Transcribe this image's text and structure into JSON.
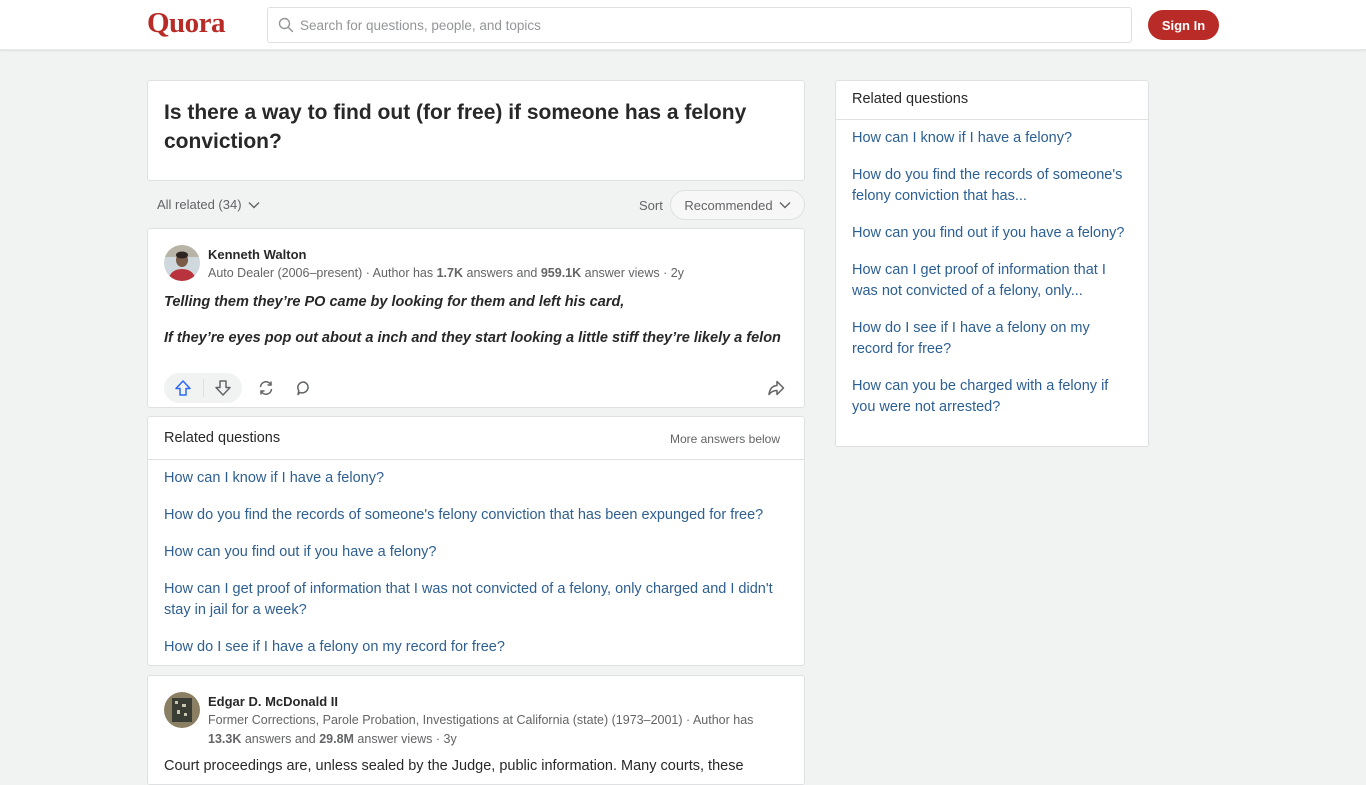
{
  "header": {
    "logo": "Quora",
    "search_placeholder": "Search for questions, people, and topics",
    "signin_label": "Sign In"
  },
  "question": {
    "title": "Is there a way to find out (for free) if someone has a felony conviction?"
  },
  "filters": {
    "all_related": "All related (34)",
    "sort_label": "Sort",
    "sort_value": "Recommended"
  },
  "answers": [
    {
      "author": "Kenneth Walton",
      "credential_prefix": "Auto Dealer (2006–present) · Author has ",
      "answers_count": "1.7K",
      "answers_mid": " answers and ",
      "views_count": "959.1K",
      "views_suffix": " answer views · 2y",
      "paragraphs": [
        "Telling them they’re PO came by looking for them and left his card,",
        "If they’re eyes pop out about a inch and they start looking a little stiff they’re likely a felon"
      ]
    },
    {
      "author": "Edgar D. McDonald II",
      "credential_prefix": "Former Corrections, Parole Probation, Investigations at California (state) (1973–2001) · Author has ",
      "answers_count": "13.3K",
      "answers_mid": " answers and ",
      "views_count": "29.8M",
      "views_suffix": " answer views · 3y",
      "paragraphs": [
        "Court proceedings are, unless sealed by the Judge, public information. Many courts, these"
      ]
    }
  ],
  "actions": {
    "upvote_icon": "arrow-up-icon",
    "downvote_icon": "arrow-down-icon",
    "share_icon": "share-icon",
    "comment_icon": "comment-icon",
    "forward_icon": "forward-icon"
  },
  "related_inline": {
    "title": "Related questions",
    "more": "More answers below",
    "items": [
      "How can I know if I have a felony?",
      "How do you find the records of someone's felony conviction that has been expunged for free?",
      "How can you find out if you have a felony?",
      "How can I get proof of information that I was not convicted of a felony, only charged and I didn't stay in jail for a week?",
      "How do I see if I have a felony on my record for free?"
    ]
  },
  "related_sidebar": {
    "title": "Related questions",
    "items": [
      "How can I know if I have a felony?",
      "How do you find the records of someone's felony conviction that has...",
      "How can you find out if you have a felony?",
      "How can I get proof of information that I was not convicted of a felony, only...",
      "How do I see if I have a felony on my record for free?",
      "How can you be charged with a felony if you were not arrested?"
    ]
  },
  "colors": {
    "brand": "#b92b27",
    "link": "#2b5f94",
    "upvote": "#2e69ff"
  }
}
